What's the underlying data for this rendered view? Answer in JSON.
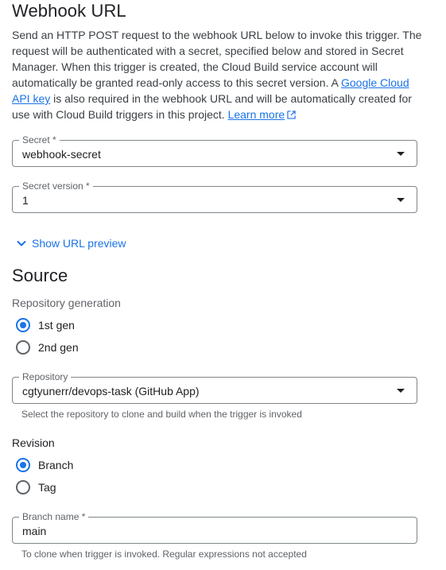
{
  "webhook": {
    "title": "Webhook URL",
    "desc_1": "Send an HTTP POST request to the webhook URL below to invoke this trigger. The request will be authenticated with a secret, specified below and stored in Secret Manager. When this trigger is created, the Cloud Build service account will automatically be granted read-only access to this secret version. A ",
    "api_key_link": "Google Cloud API key",
    "desc_2": " is also required in the webhook URL and will be automatically created for use with Cloud Build triggers in this project. ",
    "learn_more": "Learn more",
    "secret": {
      "label": "Secret *",
      "value": "webhook-secret"
    },
    "secret_version": {
      "label": "Secret version *",
      "value": "1"
    },
    "show_url_preview": "Show URL preview"
  },
  "source": {
    "title": "Source",
    "repo_generation_label": "Repository generation",
    "gen_options": [
      {
        "label": "1st gen",
        "selected": true
      },
      {
        "label": "2nd gen",
        "selected": false
      }
    ],
    "repository": {
      "label": "Repository",
      "value": "cgtyunerr/devops-task (GitHub App)",
      "hint": "Select the repository to clone and build when the trigger is invoked"
    },
    "revision_label": "Revision",
    "revision_options": [
      {
        "label": "Branch",
        "selected": true
      },
      {
        "label": "Tag",
        "selected": false
      }
    ],
    "branch_name": {
      "label": "Branch name *",
      "value": "main",
      "hint": "To clone when trigger is invoked. Regular expressions not accepted"
    }
  },
  "colors": {
    "accent": "#1a73e8",
    "text": "#202124",
    "secondary": "#5f6368",
    "border": "#80868b"
  },
  "icons": {
    "external": "open-in-new-icon",
    "expand": "chevron-down-icon",
    "dropdown": "dropdown-arrow-icon"
  }
}
